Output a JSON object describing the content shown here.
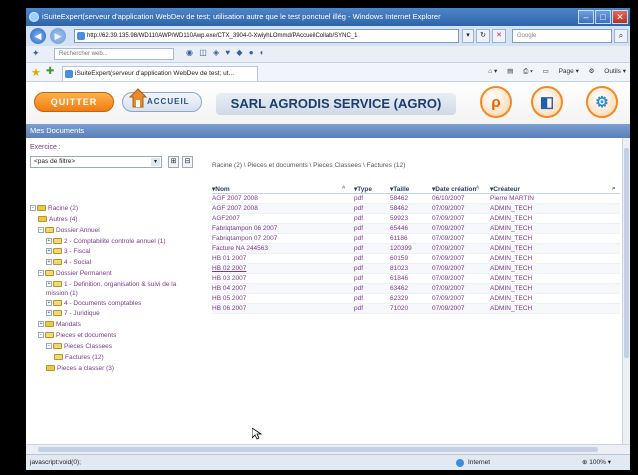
{
  "window": {
    "title": "iSuiteExpert(serveur d'application WebDev de test; utilisation autre que le test ponctuel illég - Windows Internet Explorer"
  },
  "address": {
    "url": "http://62.39.135.98/WD110AWP/WD110Awp.exe/CTX_3904-0-XwiyhLOmmd/PAccueilCollab/SYNC_1",
    "search_placeholder": "Google"
  },
  "toolbar2": {
    "search_placeholder": "Rechercher web..."
  },
  "tab": {
    "label": "iSuiteExpert(serveur d'application WebDev de test; ut...",
    "page_label": "Page",
    "tools_label": "Outils"
  },
  "app": {
    "quit_label": "QUITTER",
    "home_label": "ACCUEIL",
    "company": "SARL AGRODIS SERVICE (AGRO)",
    "section_title": "Mes Documents"
  },
  "sidebar": {
    "exercice_label": "Exercice :",
    "filter_value": "<pas de filtre>",
    "tree": [
      {
        "label": "Racine (2)",
        "level": 0,
        "toggle": "−",
        "folder": true
      },
      {
        "label": "Autres (4)",
        "level": 1,
        "toggle": "",
        "folder": true
      },
      {
        "label": "Dossier Annuel",
        "level": 1,
        "toggle": "−",
        "folder": false
      },
      {
        "label": "2 - Comptabilite controle annuel (1)",
        "level": 2,
        "toggle": "+",
        "folder": false
      },
      {
        "label": "3 - Fiscal",
        "level": 2,
        "toggle": "+",
        "folder": false
      },
      {
        "label": "4 - Social",
        "level": 2,
        "toggle": "+",
        "folder": false
      },
      {
        "label": "Dossier Permanent",
        "level": 1,
        "toggle": "−",
        "folder": false
      },
      {
        "label": "1 - Definition, organisation & suivi de la mission (1)",
        "level": 2,
        "toggle": "+",
        "folder": false
      },
      {
        "label": "4 - Documents comptables",
        "level": 2,
        "toggle": "+",
        "folder": false
      },
      {
        "label": "7 - Juridique",
        "level": 2,
        "toggle": "+",
        "folder": false
      },
      {
        "label": "Mandats",
        "level": 1,
        "toggle": "+",
        "folder": true
      },
      {
        "label": "Pieces et documents",
        "level": 1,
        "toggle": "−",
        "folder": false
      },
      {
        "label": "Pieces Classees",
        "level": 2,
        "toggle": "−",
        "folder": false
      },
      {
        "label": "Factures (12)",
        "level": 3,
        "toggle": "",
        "folder": false
      },
      {
        "label": "Pieces a classer (3)",
        "level": 2,
        "toggle": "",
        "folder": true
      }
    ]
  },
  "main": {
    "breadcrumb": "Racine (2) \\ Pieces et documents \\ Pieces Classees \\ Factures (12)",
    "columns": {
      "nom": "Nom",
      "type": "Type",
      "taille": "Taille",
      "date": "Date création",
      "createur": "Créateur"
    },
    "rows": [
      {
        "nom": "AGF 2007 2008",
        "type": "pdf",
        "taille": "58462",
        "date": "06/10/2007",
        "createur": "Pierre MARTIN"
      },
      {
        "nom": "AGF 2007 2008",
        "type": "pdf",
        "taille": "58462",
        "date": "07/09/2007",
        "createur": "ADMIN_TECH"
      },
      {
        "nom": "AGF2007",
        "type": "pdf",
        "taille": "59923",
        "date": "07/09/2007",
        "createur": "ADMIN_TECH"
      },
      {
        "nom": "Fabriqtampon 06 2007",
        "type": "pdf",
        "taille": "65446",
        "date": "07/09/2007",
        "createur": "ADMIN_TECH"
      },
      {
        "nom": "Fabriqtampon 07 2007",
        "type": "pdf",
        "taille": "61186",
        "date": "07/09/2007",
        "createur": "ADMIN_TECH"
      },
      {
        "nom": "Facture NA 244563",
        "type": "pdf",
        "taille": "120399",
        "date": "07/09/2007",
        "createur": "ADMIN_TECH"
      },
      {
        "nom": "HB 01 2007",
        "type": "pdf",
        "taille": "60159",
        "date": "07/09/2007",
        "createur": "ADMIN_TECH"
      },
      {
        "nom": "HB 02 2007",
        "type": "pdf",
        "taille": "81023",
        "date": "07/09/2007",
        "createur": "ADMIN_TECH"
      },
      {
        "nom": "HB 03 2007",
        "type": "pdf",
        "taille": "61846",
        "date": "07/09/2007",
        "createur": "ADMIN_TECH"
      },
      {
        "nom": "HB 04 2007",
        "type": "pdf",
        "taille": "63462",
        "date": "07/09/2007",
        "createur": "ADMIN_TECH"
      },
      {
        "nom": "HB 05 2007",
        "type": "pdf",
        "taille": "62329",
        "date": "07/09/2007",
        "createur": "ADMIN_TECH"
      },
      {
        "nom": "HB 06 2007",
        "type": "pdf",
        "taille": "71020",
        "date": "07/09/2007",
        "createur": "ADMIN_TECH"
      }
    ]
  },
  "status": {
    "left": "javascript:void(0);",
    "zone": "Internet",
    "zoom": "100%"
  },
  "colors": {
    "brand_orange": "#f07d12",
    "title_blue": "#1c3d6e",
    "link_purple": "#7a3a8a",
    "section_bar": "#5a7fb8"
  }
}
